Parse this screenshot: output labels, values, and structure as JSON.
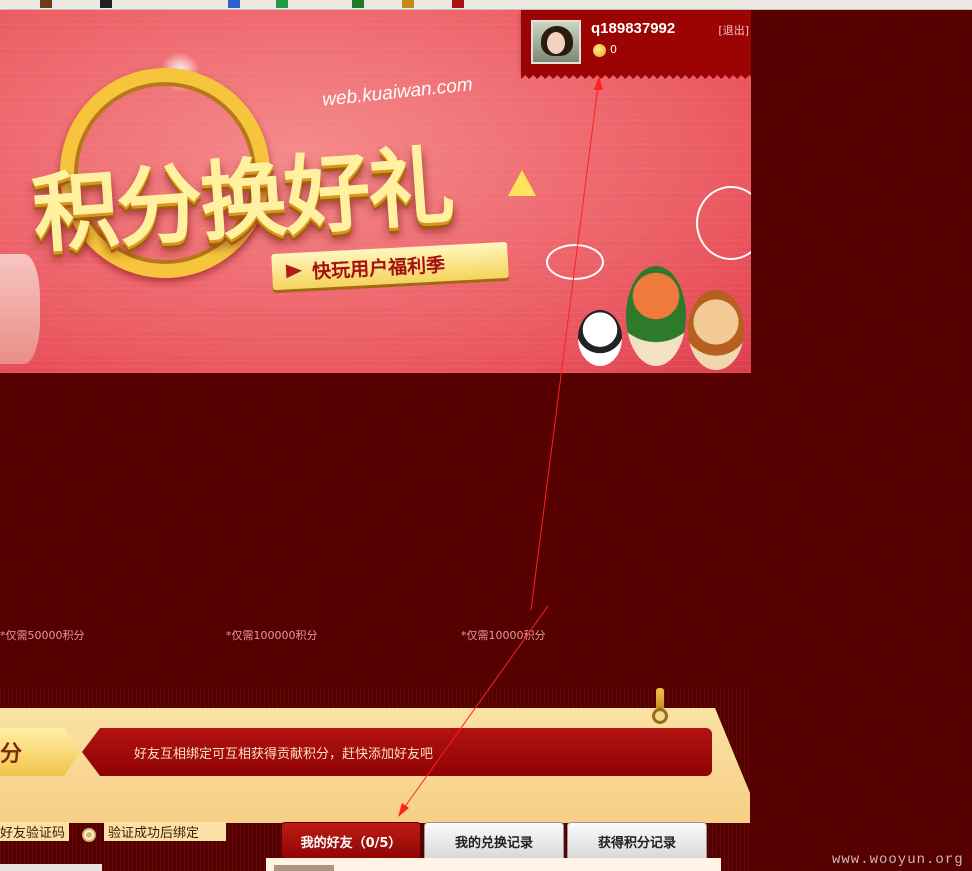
{
  "banner": {
    "site_url": "web.kuaiwan.com",
    "headline": "积分换好礼",
    "subtitle": "快玩用户福利季"
  },
  "user": {
    "username": "q189837992",
    "logout_label": "[退出]",
    "points": "0"
  },
  "prices": [
    "*仅需50000积分",
    "*仅需100000积分",
    "*仅需10000积分"
  ],
  "section": {
    "score_tag": "分",
    "notice": "好友互相绑定可互相获得贡献积分，赶快添加好友吧"
  },
  "bind": {
    "code_label": "好友验证码",
    "after_label": "验证成功后绑定"
  },
  "tabs": [
    {
      "label": "我的好友（0/5）",
      "active": true
    },
    {
      "label": "我的兑换记录",
      "active": false
    },
    {
      "label": "获得积分记录",
      "active": false
    }
  ],
  "watermark": "www.wooyun.org",
  "colors": {
    "page_bg": "#5a0000",
    "banner_pink": "#ef6e73",
    "gold": "#f6c53c",
    "user_panel": "#9c0404",
    "annotation_arrow": "#ff2020"
  }
}
